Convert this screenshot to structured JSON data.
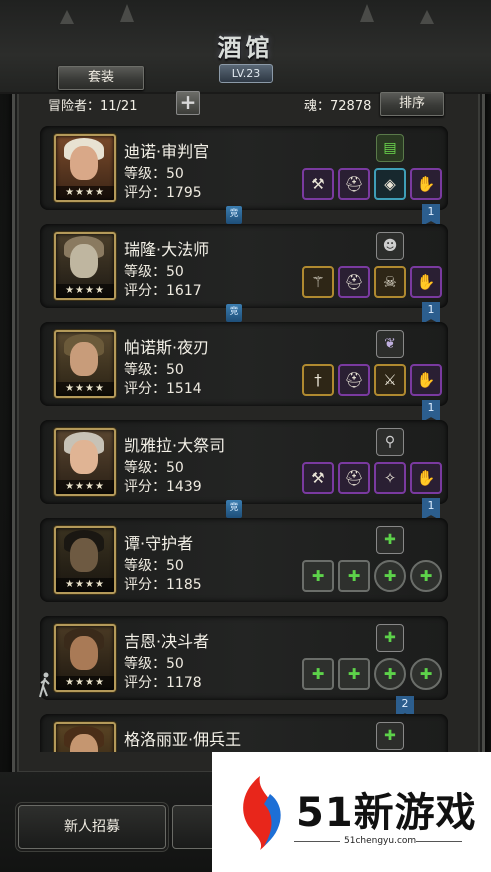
{
  "window": {
    "title": "酒馆",
    "level": "LV.23"
  },
  "toolbar": {
    "set_button": "套装",
    "sort_button": "排序",
    "add_symbol": "+"
  },
  "stats": {
    "adventurers": "冒险者：11/21",
    "soul": "魂：72878"
  },
  "heroes": [
    {
      "name": "迪诺·审判官",
      "level": "等级：50",
      "score": "评分：1795",
      "stars": "★★★★"
    },
    {
      "name": "瑞隆·大法师",
      "level": "等级：50",
      "score": "评分：1617",
      "stars": "★★★★"
    },
    {
      "name": "帕诺斯·夜刃",
      "level": "等级：50",
      "score": "评分：1514",
      "stars": "★★★★"
    },
    {
      "name": "凯雅拉·大祭司",
      "level": "等级：50",
      "score": "评分：1439",
      "stars": "★★★★"
    },
    {
      "name": "谭·守护者",
      "level": "等级：50",
      "score": "评分：1185",
      "stars": "★★★★"
    },
    {
      "name": "吉恩·决斗者",
      "level": "等级：50",
      "score": "评分：1178",
      "stars": "★★★★"
    },
    {
      "name": "格洛丽亚·佣兵王",
      "level": "",
      "score": "",
      "stars": ""
    }
  ],
  "tags": {
    "compete": "竞",
    "rank1": "1",
    "rank2": "2"
  },
  "bottom": {
    "recruit_button": "新人招募"
  },
  "watermark": {
    "brand": "51新游戏",
    "url": "51chengyu.com"
  },
  "colors": {
    "rare_purple": "#7a3aa0",
    "legend_gold": "#b08a30",
    "cyan": "#3f9fb8",
    "accent_blue": "#2c5e8e"
  }
}
